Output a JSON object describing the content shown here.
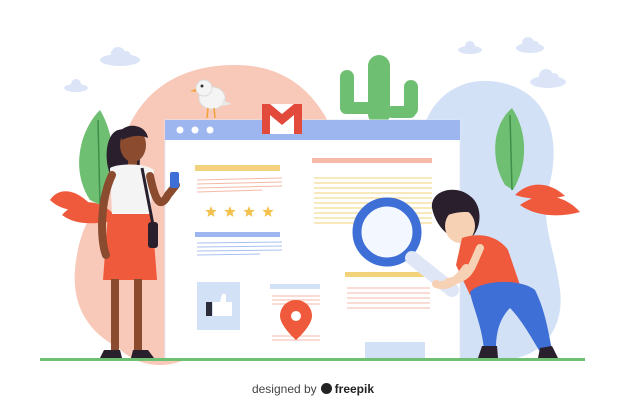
{
  "illustration": {
    "rating_stars": 4,
    "browser_dots": 3
  },
  "credit": {
    "prefix": "designed by",
    "brand": "freepik"
  },
  "colors": {
    "blob_pink": "#f8c8b8",
    "blob_blue": "#d3e1f7",
    "browser_bar": "#9db6ef",
    "star": "#f2c14e",
    "magnifier": "#3e6fd6",
    "pin": "#f05a3c",
    "gmail_red": "#e24a3b"
  }
}
